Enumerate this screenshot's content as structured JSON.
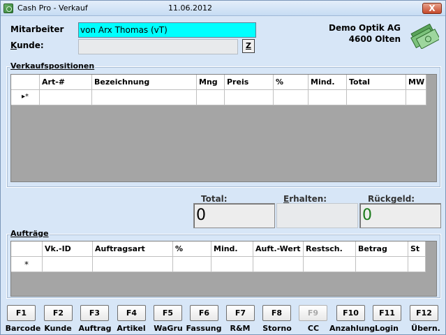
{
  "window": {
    "title": "Cash Pro - Verkauf",
    "date": "11.06.2012",
    "close_label": "X"
  },
  "header": {
    "mitarbeiter_label": "Mitarbeiter",
    "mitarbeiter_value": "von Arx Thomas (vT)",
    "kunde_label": "Kunde:",
    "kunde_value": "",
    "z_button": "Z",
    "company_name": "Demo Optik AG",
    "company_city": "4600 Olten"
  },
  "verkauf": {
    "title": "Verkaufspositionen",
    "columns": [
      "",
      "Art-#",
      "Bezeichnung",
      "Mng",
      "Preis",
      "%",
      "Mind.",
      "Total",
      "MW"
    ],
    "new_row_marker": "▸*"
  },
  "totals": {
    "total_label": "Total:",
    "total_value": "0",
    "erhalten_label": "Erhalten:",
    "erhalten_value": "",
    "rueckgeld_label": "Rückgeld:",
    "rueckgeld_value": "0",
    "rueckgeld_color": "#1b7a1b"
  },
  "auftraege": {
    "title": "Aufträge",
    "columns": [
      "",
      "Vk.-ID",
      "Auftragsart",
      "%",
      "Mind.",
      "Auft.-Wert",
      "Restsch.",
      "Betrag",
      "St"
    ],
    "new_row_marker": "*"
  },
  "fkeys": [
    {
      "key": "F1",
      "label": "Barcode",
      "enabled": true
    },
    {
      "key": "F2",
      "label": "Kunde",
      "enabled": true
    },
    {
      "key": "F3",
      "label": "Auftrag",
      "enabled": true
    },
    {
      "key": "F4",
      "label": "Artikel",
      "enabled": true
    },
    {
      "key": "F5",
      "label": "WaGru",
      "enabled": true
    },
    {
      "key": "F6",
      "label": "Fassung",
      "enabled": true
    },
    {
      "key": "F7",
      "label": "R&M",
      "enabled": true
    },
    {
      "key": "F8",
      "label": "Storno",
      "enabled": true
    },
    {
      "key": "F9",
      "label": "CC",
      "enabled": false
    },
    {
      "key": "F10",
      "label": "Anzahlung",
      "enabled": true
    },
    {
      "key": "F11",
      "label": "Login",
      "enabled": true
    },
    {
      "key": "F12",
      "label": "Übern.",
      "enabled": true
    }
  ],
  "icons": {
    "app": "cash-app-icon",
    "money": "money-bills-icon"
  }
}
